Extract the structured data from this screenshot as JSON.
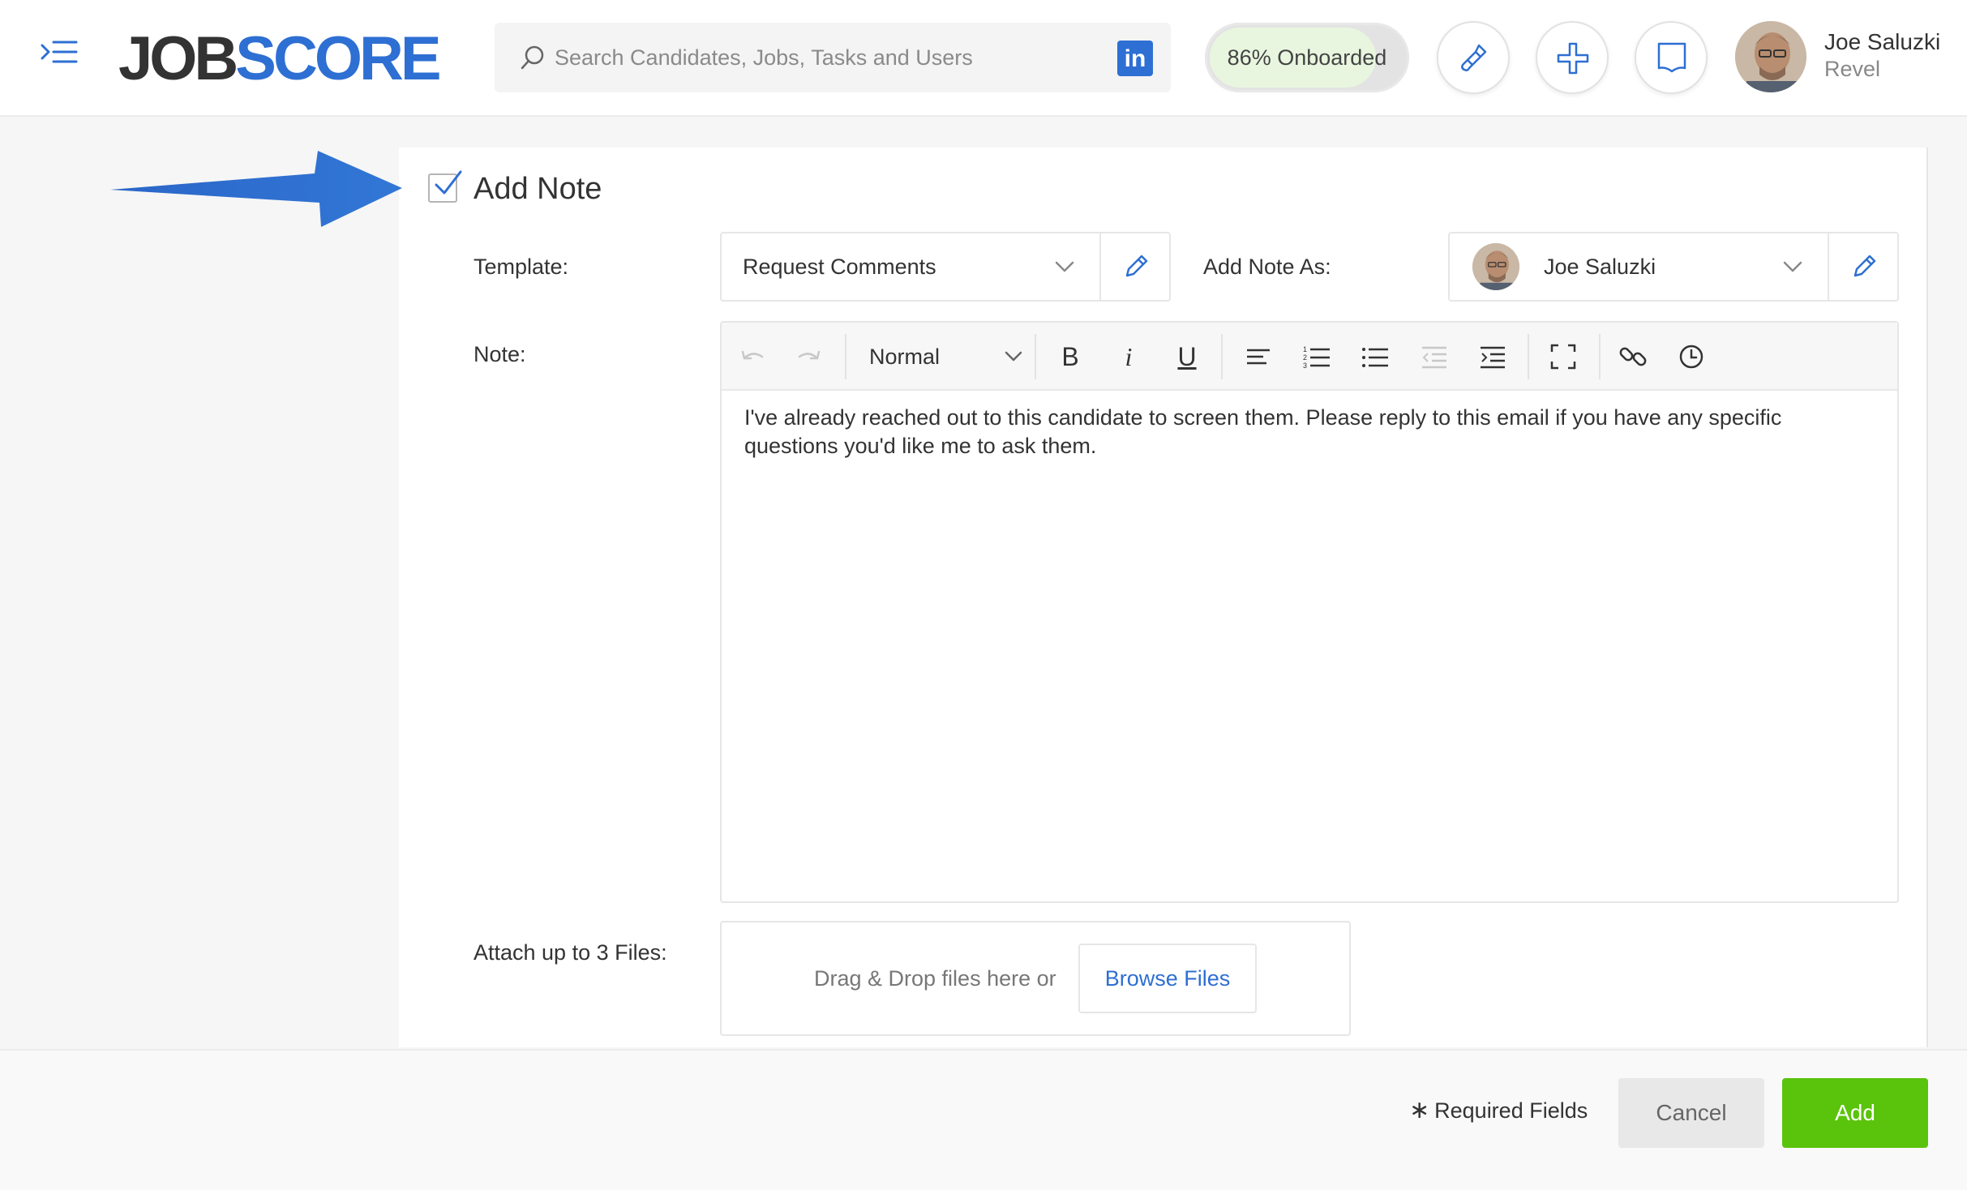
{
  "header": {
    "logo": {
      "part1": "JOB",
      "part2": "SCORE"
    },
    "search": {
      "placeholder": "Search Candidates, Jobs, Tasks and Users"
    },
    "linkedin_label": "in",
    "onboarding": {
      "label": "86% Onboarded",
      "fraction": 0.86
    },
    "icons": [
      "menu-icon",
      "search-icon",
      "linkedin-icon",
      "wrench-icon",
      "plus-icon",
      "book-icon"
    ],
    "user": {
      "name": "Joe Saluzki",
      "org": "Revel"
    }
  },
  "form": {
    "title": "Add Note",
    "checked": true,
    "template": {
      "label": "Template:",
      "value": "Request Comments"
    },
    "add_note_as": {
      "label": "Add Note As:",
      "value": "Joe Saluzki"
    },
    "note": {
      "label": "Note:",
      "format": "Normal",
      "toolbar": {
        "bold": "B",
        "italic": "i",
        "underline": "U"
      },
      "text": "I've already reached out to this candidate to screen them.  Please reply to this email if you have any specific questions you'd like me to ask them."
    },
    "attach": {
      "label": "Attach up to 3 Files:",
      "drop_text": "Drag & Drop files here or",
      "browse_label": "Browse Files"
    }
  },
  "footer": {
    "required_star": "∗",
    "required_label": "Required Fields",
    "cancel_label": "Cancel",
    "add_label": "Add"
  },
  "colors": {
    "brand_blue": "#2e6fd3",
    "add_green": "#5ac30b",
    "onboard_fill": "#e9f6df"
  }
}
